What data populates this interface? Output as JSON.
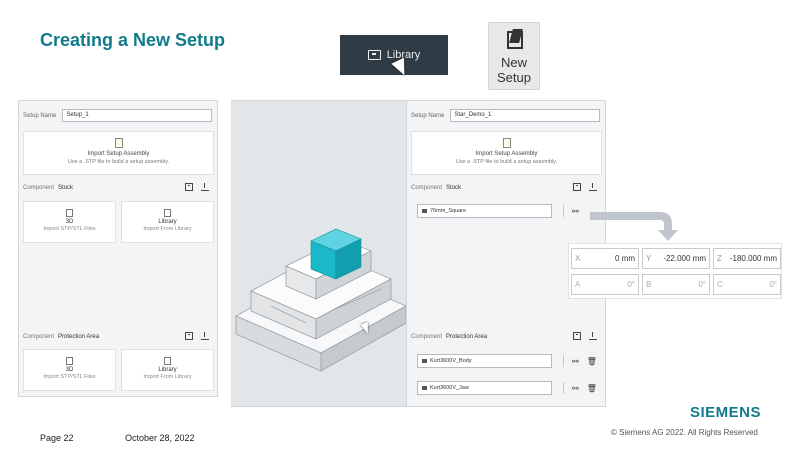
{
  "slide": {
    "title": "Creating a New Setup",
    "page_label": "Page 22",
    "date": "October 28, 2022",
    "logo": "SIEMENS",
    "copyright": "© Siemens AG 2022.  All Rights Reserved"
  },
  "library_button": {
    "label": "Library",
    "icon": "library-box-icon"
  },
  "new_setup_button": {
    "line1": "New",
    "line2": "Setup",
    "icon": "new-setup-icon"
  },
  "left_panel": {
    "setup_name_label": "Setup Name",
    "setup_name_value": "Setup_1",
    "import_title": "Import Setup Assembly",
    "import_sub": "Use a .STP file to build a setup assembly.",
    "stock_head_label": "Component",
    "stock_head_value": "Stock",
    "tile_3d_title": "3D",
    "tile_3d_sub": "Import STP/STL Files",
    "tile_lib_title": "Library",
    "tile_lib_sub": "Import From Library",
    "prot_head_label": "Component",
    "prot_head_value": "Protection Area",
    "tile2_3d_title": "3D",
    "tile2_3d_sub": "Import STP/STL Files",
    "tile2_lib_title": "Library",
    "tile2_lib_sub": "Import From Library"
  },
  "right_panel": {
    "setup_name_label": "Setup Name",
    "setup_name_value": "Star_Demo_1",
    "import_title": "Import Setup Assembly",
    "import_sub": "Use a .STP file to build a setup assembly.",
    "stock_head_label": "Component",
    "stock_head_value": "Stock",
    "stock_item": "76mm_Square",
    "prot_head_label": "Component",
    "prot_head_value": "Protection Area",
    "prot_items": [
      "Kurt3600V_Body",
      "Kurt3600V_Jaw"
    ]
  },
  "coordinates": {
    "x_label": "X",
    "x_value": "0 mm",
    "y_label": "Y",
    "y_value": "-22.000 mm",
    "z_label": "Z",
    "z_value": "-180.000 mm",
    "a_label": "A",
    "a_value": "0°",
    "b_label": "B",
    "b_value": "0°",
    "c_label": "C",
    "c_value": "0°"
  },
  "colors": {
    "accent": "#117a8b",
    "stock_cube": "#1ab8c9",
    "dark_button": "#2f3b45"
  }
}
